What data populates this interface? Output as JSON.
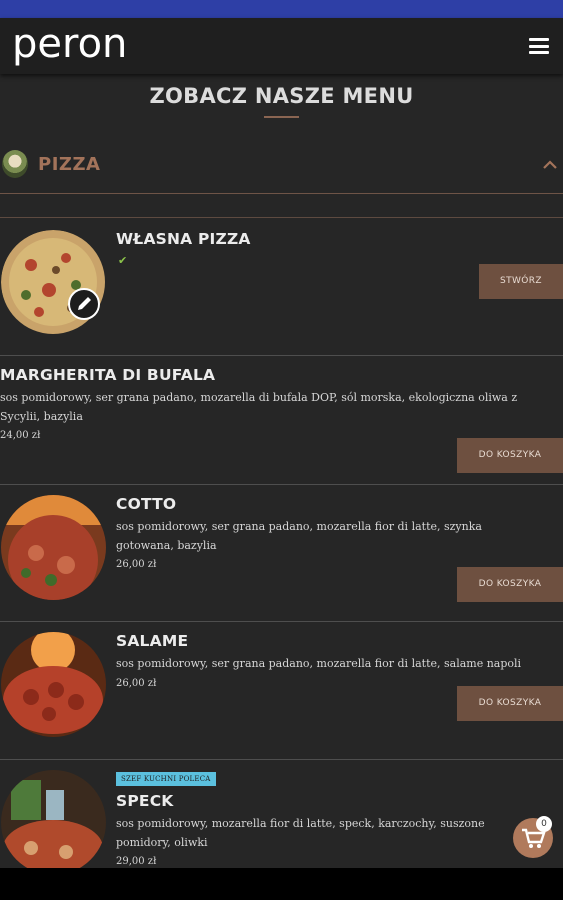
{
  "app": {
    "logo": "peron",
    "menu_icon": "hamburger-menu-icon"
  },
  "page": {
    "section_title": "ZOBACZ NASZE MENU"
  },
  "category": {
    "name": "PIZZA",
    "icon": "pizza-category-icon",
    "toggle_icon": "chevron-up-icon"
  },
  "items": [
    {
      "name": "WŁASNA PIZZA",
      "check": "✔",
      "button": "STWÓRZ"
    },
    {
      "name": "MARGHERITA DI BUFALA",
      "description": "sos pomidorowy, ser grana padano, mozarella di bufala DOP, sól morska, ekologiczna oliwa z Sycylii, bazylia",
      "price": "24,00 zł",
      "button": "DO KOSZYKA"
    },
    {
      "name": "COTTO",
      "description": "sos pomidorowy, ser grana padano, mozarella fior di latte, szynka gotowana, bazylia",
      "price": "26,00 zł",
      "button": "DO KOSZYKA"
    },
    {
      "name": "SALAME",
      "description": "sos pomidorowy, ser grana padano, mozarella fior di latte, salame napoli",
      "price": "26,00 zł",
      "button": "DO KOSZYKA"
    },
    {
      "name": "SPECK",
      "badge": "SZEF KUCHNI POLECA",
      "description": "sos pomidorowy, mozarella fior di latte, speck, karczochy, suszone pomidory, oliwki",
      "price": "29,00 zł"
    }
  ],
  "cart": {
    "count": "0",
    "icon": "shopping-cart-icon"
  },
  "colors": {
    "accent": "#6e5040",
    "category": "#a3735a",
    "status_bar": "#2e3fa6"
  }
}
